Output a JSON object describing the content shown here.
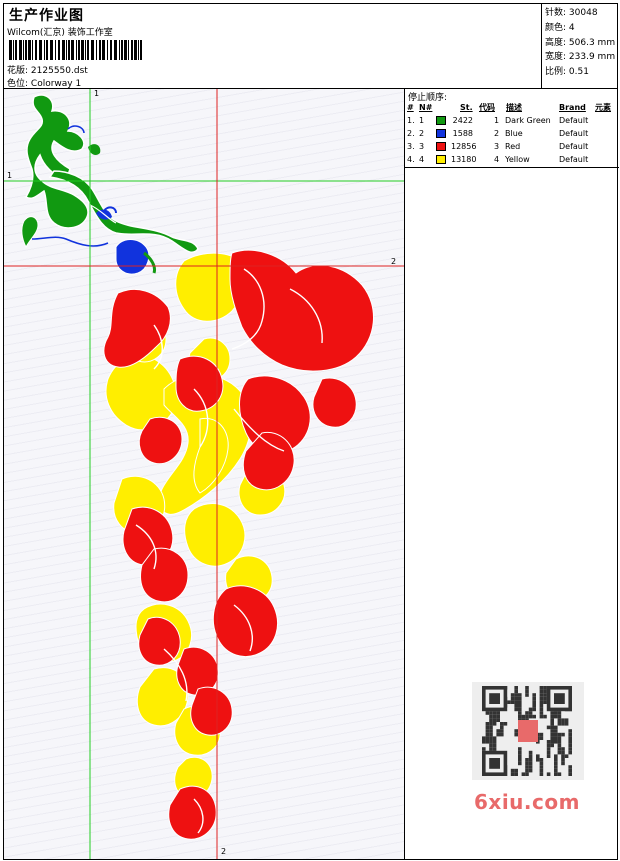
{
  "header": {
    "title": "生产作业图",
    "studio": "Wilcom(汇京) 装饰工作室",
    "design_label": "花版:",
    "design_value": "2125550.dst",
    "colorway_label": "色位:",
    "colorway_value": "Colorway 1"
  },
  "stats": [
    {
      "label": "针数:",
      "value": "30048"
    },
    {
      "label": "颜色:",
      "value": "4"
    },
    {
      "label": "高度:",
      "value": "506.3 mm"
    },
    {
      "label": "宽度:",
      "value": "233.9 mm"
    },
    {
      "label": "比例:",
      "value": "0.51"
    }
  ],
  "stop_sequence": {
    "title": "停止顺序:",
    "columns": [
      "#",
      "N#",
      "St.",
      "代码",
      "描述",
      "Brand",
      "元素"
    ],
    "rows": [
      {
        "num": "1.",
        "n": "1",
        "color": "#119911",
        "st": "2422",
        "code": "1",
        "desc": "Dark Green",
        "brand": "Default"
      },
      {
        "num": "2.",
        "n": "2",
        "color": "#1133dd",
        "st": "1588",
        "code": "2",
        "desc": "Blue",
        "brand": "Default"
      },
      {
        "num": "3.",
        "n": "3",
        "color": "#ee1111",
        "st": "12856",
        "code": "3",
        "desc": "Red",
        "brand": "Default"
      },
      {
        "num": "4.",
        "n": "4",
        "color": "#ffee00",
        "st": "13180",
        "code": "4",
        "desc": "Yellow",
        "brand": "Default"
      }
    ]
  },
  "guides": {
    "v1_label": "1",
    "h1_label": "1",
    "h2_label": "2",
    "v2_label": "2"
  },
  "colors": {
    "green": "#119911",
    "blue": "#1133dd",
    "red": "#ee1111",
    "yellow": "#ffee00",
    "guide_green": "#22cc22",
    "guide_red": "#dd2222"
  },
  "watermark": "6xiu.com"
}
